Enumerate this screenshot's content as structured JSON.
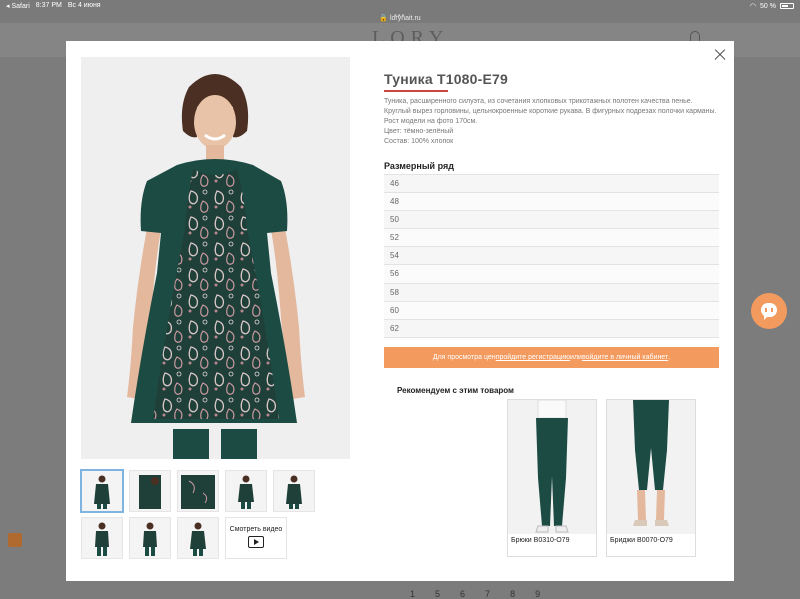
{
  "statusbar": {
    "app": "◂ Safari",
    "time": "8:37 PM",
    "date": "Вс 4 июня",
    "battery": "50 %"
  },
  "urlbar": {
    "url": "🔒 lorynait.ru"
  },
  "background": {
    "logo": "LORY",
    "pagination": [
      "1",
      "5",
      "6",
      "7",
      "8",
      "9"
    ]
  },
  "product": {
    "title": "Туника Т1080-Е79",
    "description": "Туника, расширенного силуэта, из сочетания хлопковых трикотажных полотен качества пенье. Круглый вырез горловины, цельнокроенные короткие рукава. В фигурных подрезах полочки карманы. Рост модели на фото 170см.",
    "color": "Цвет: тёмно-зелёный",
    "composition": "Состав: 100% хлопок",
    "sizes_label": "Размерный ряд",
    "sizes": [
      "46",
      "48",
      "50",
      "52",
      "54",
      "56",
      "58",
      "60",
      "62"
    ]
  },
  "login_banner": {
    "prefix": "Для просмотра цен ",
    "register_link": "пройдите регистрацию",
    "middle": " или ",
    "login_link": "войдите в личный кабинет",
    "suffix": "."
  },
  "video_thumb": {
    "label": "Смотреть видео"
  },
  "recommendations": {
    "label": "Рекомендуем с этим товаром",
    "items": [
      {
        "name": "Брюки В0310-О79"
      },
      {
        "name": "Бриджи В0070-О79"
      }
    ]
  },
  "colors": {
    "accent": "#c9473f",
    "banner": "#f39a5f",
    "garment": "#1f4f45"
  }
}
